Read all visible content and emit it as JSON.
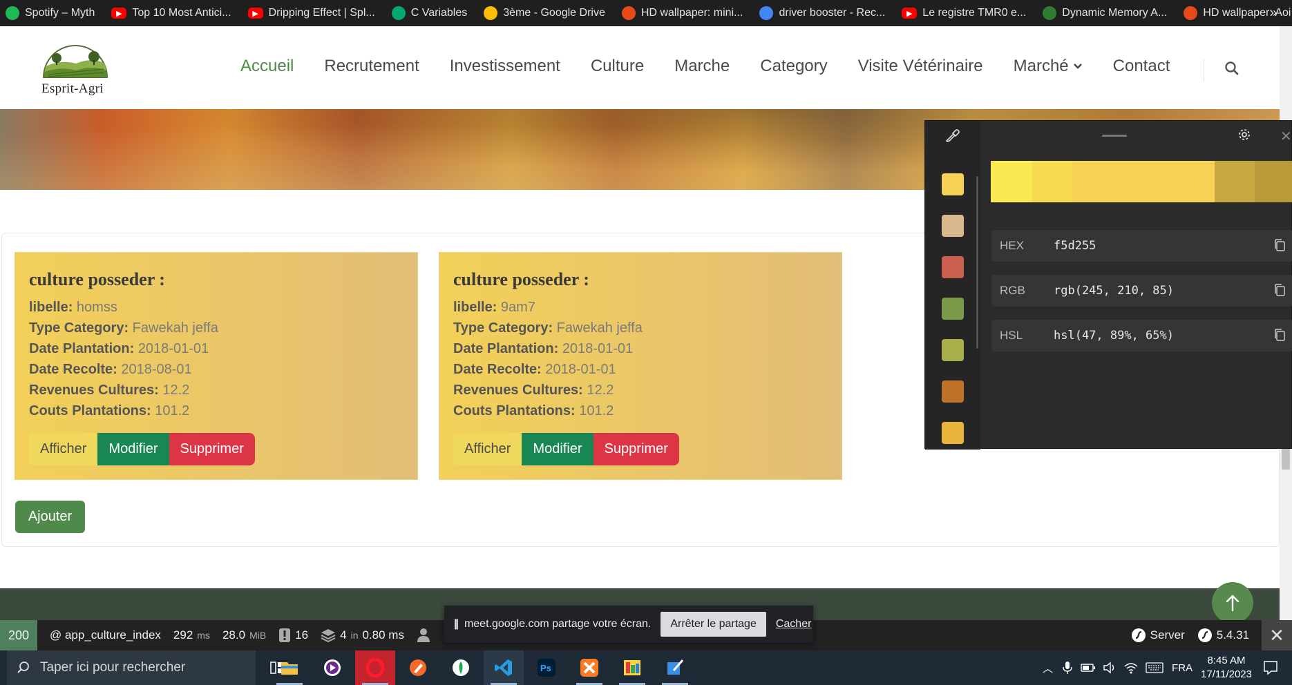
{
  "bookmarks": [
    {
      "label": "Spotify – Myth",
      "icon": "spotify-icon",
      "color": "#1db954"
    },
    {
      "label": "Top 10 Most Antici...",
      "icon": "youtube-icon",
      "color": "#ff0000"
    },
    {
      "label": "Dripping Effect | Spl...",
      "icon": "youtube-icon",
      "color": "#ff0000"
    },
    {
      "label": "C Variables",
      "icon": "w3schools-icon",
      "color": "#04aa6d"
    },
    {
      "label": "3ème - Google Drive",
      "icon": "google-drive-icon",
      "color": "#fbbc04"
    },
    {
      "label": "HD wallpaper: mini...",
      "icon": "wallpaper-flame-icon",
      "color": "#e64a19"
    },
    {
      "label": "driver booster - Rec...",
      "icon": "google-icon",
      "color": "#4285f4"
    },
    {
      "label": "Le registre TMR0 e...",
      "icon": "youtube-icon",
      "color": "#ff0000"
    },
    {
      "label": "Dynamic Memory A...",
      "icon": "link-icon",
      "color": "#2e7d32"
    },
    {
      "label": "HD wallpaper: Aoi...",
      "icon": "wallpaper-flame-icon",
      "color": "#e64a19"
    }
  ],
  "bookmarks_more": "»",
  "site": {
    "logo_text": "Esprit-Agri",
    "nav": [
      "Accueil",
      "Recrutement",
      "Investissement",
      "Culture",
      "Marche",
      "Category",
      "Visite Vétérinaire",
      "Marché",
      "Contact"
    ],
    "accent": "#4c8a45"
  },
  "cards": [
    {
      "title": "culture posseder :",
      "fields": [
        {
          "label": "libelle:",
          "value": "homss"
        },
        {
          "label": "Type Category:",
          "value": "Fawekah jeffa"
        },
        {
          "label": "Date Plantation:",
          "value": "2018-01-01"
        },
        {
          "label": "Date Recolte:",
          "value": "2018-08-01"
        },
        {
          "label": "Revenues Cultures:",
          "value": "12.2"
        },
        {
          "label": "Couts Plantations:",
          "value": "101.2"
        }
      ],
      "buttons": {
        "show": "Afficher",
        "edit": "Modifier",
        "delete": "Supprimer"
      }
    },
    {
      "title": "culture posseder :",
      "fields": [
        {
          "label": "libelle:",
          "value": "9am7"
        },
        {
          "label": "Type Category:",
          "value": "Fawekah jeffa"
        },
        {
          "label": "Date Plantation:",
          "value": "2018-01-01"
        },
        {
          "label": "Date Recolte:",
          "value": "2018-01-01"
        },
        {
          "label": "Revenues Cultures:",
          "value": "12.2"
        },
        {
          "label": "Couts Plantations:",
          "value": "101.2"
        }
      ],
      "buttons": {
        "show": "Afficher",
        "edit": "Modifier",
        "delete": "Supprimer"
      }
    }
  ],
  "add_button": "Ajouter",
  "symfony_toolbar": {
    "status": "200",
    "route": "@ app_culture_index",
    "time_value": "292",
    "time_unit": "ms",
    "memory_value": "28.0",
    "memory_unit": "MiB",
    "logs_count": "16",
    "db_queries": "4",
    "db_in": "in",
    "db_time": "0.80 ms",
    "server_label": "Server",
    "version": "5.4.31"
  },
  "meet_banner": {
    "message": "meet.google.com partage votre écran.",
    "stop_label": "Arrêter le partage",
    "hide_label": "Cacher"
  },
  "color_picker": {
    "swatches": [
      "#f5d255",
      "#d8b88c",
      "#cc6050",
      "#7a9a48",
      "#a9b04a",
      "#c07228",
      "#e8b43c"
    ],
    "shades": [
      "#fce850",
      "#f7dc52",
      "#f5d255",
      "#c8a840",
      "#b89a38"
    ],
    "rows": [
      {
        "label": "HEX",
        "value": "f5d255"
      },
      {
        "label": "RGB",
        "value": "rgb(245, 210, 85)"
      },
      {
        "label": "HSL",
        "value": "hsl(47, 89%, 65%)"
      }
    ]
  },
  "taskbar": {
    "search_placeholder": "Taper ici pour rechercher",
    "apps": [
      "task-view-icon",
      "file-explorer-icon",
      "media-player-icon",
      "opera-icon",
      "vector-app-icon",
      "mongodb-compass-icon",
      "vscode-icon",
      "photoshop-icon",
      "xampp-icon",
      "image-viewer-icon",
      "snip-icon"
    ],
    "language": "FRA",
    "time": "8:45 AM",
    "date": "17/11/2023"
  }
}
